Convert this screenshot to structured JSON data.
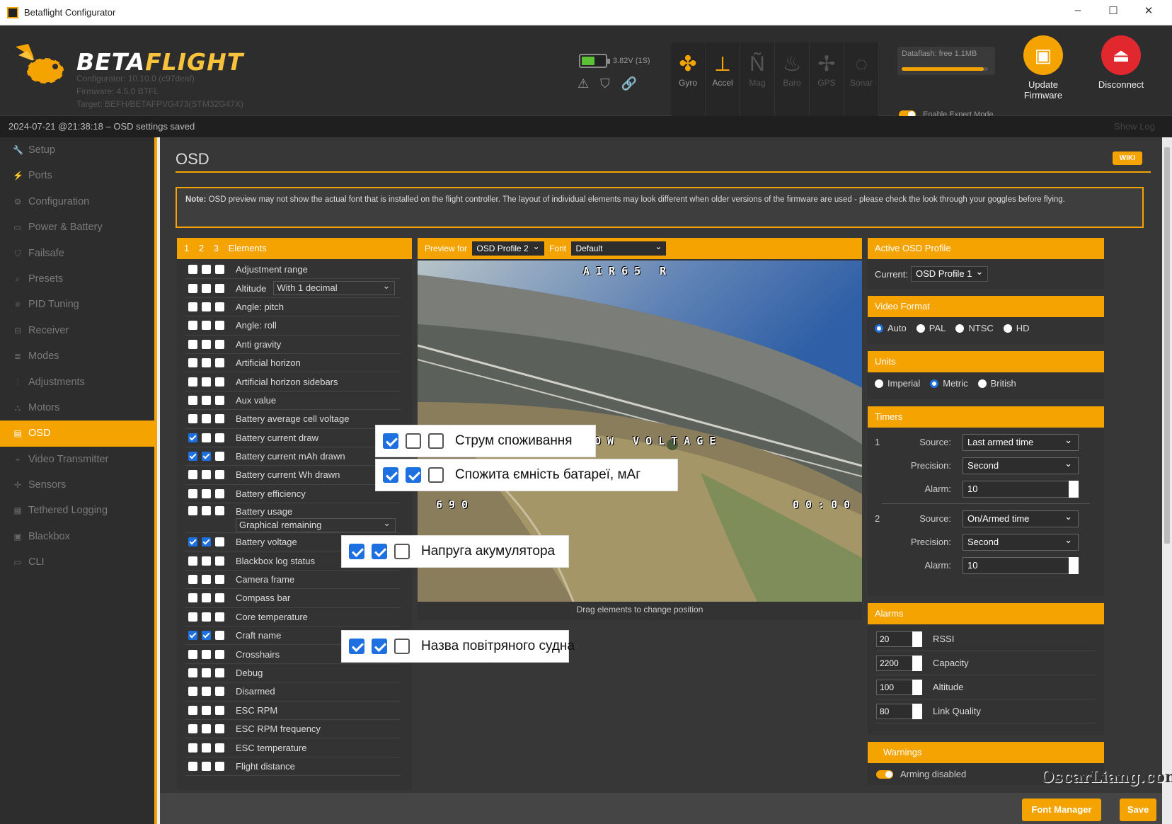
{
  "window": {
    "title": "Betaflight Configurator",
    "buttons": [
      "–",
      "☐",
      "✕"
    ]
  },
  "header": {
    "logo": {
      "betaflight_left": "BETA",
      "betaflight_right": "FLIGHT"
    },
    "fw_lines": [
      "Configurator: 10.10.0 (c97deaf)",
      "Firmware: 4.5.0 BTFL",
      "Target: BEFH/BETAFPVG473(STM32G47X)"
    ],
    "battery": {
      "voltage": "3.82V (1S)",
      "level": 0.55,
      "color": "#5bc236"
    },
    "status_icons": [
      "warning-icon",
      "shield-icon",
      "link-icon"
    ],
    "sensors": [
      {
        "label": "Gyro",
        "icon": "gyro-icon",
        "active": true
      },
      {
        "label": "Accel",
        "icon": "accel-icon",
        "active": true
      },
      {
        "label": "Mag",
        "icon": "mag-icon",
        "active": false
      },
      {
        "label": "Baro",
        "icon": "baro-icon",
        "active": false
      },
      {
        "label": "GPS",
        "icon": "gps-icon",
        "active": false
      },
      {
        "label": "Sonar",
        "icon": "sonar-icon",
        "active": false
      }
    ],
    "dataflash": {
      "label": "Dataflash: free 1.1MB",
      "used": 0.95
    },
    "expert_mode": "Enable Expert Mode",
    "update_firmware": {
      "line1": "Update",
      "line2": "Firmware",
      "color": "#f5a300"
    },
    "disconnect": {
      "label": "Disconnect",
      "color": "#e0282e"
    }
  },
  "statusbar": {
    "message": "2024-07-21 @21:38:18 – OSD settings saved",
    "show_log": "Show Log"
  },
  "sidebar": {
    "items": [
      {
        "label": "Setup",
        "icon": "wrench-icon"
      },
      {
        "label": "Ports",
        "icon": "plug-icon"
      },
      {
        "label": "Configuration",
        "icon": "gear-icon"
      },
      {
        "label": "Power & Battery",
        "icon": "battery-icon"
      },
      {
        "label": "Failsafe",
        "icon": "shield-icon"
      },
      {
        "label": "Presets",
        "icon": "search-icon"
      },
      {
        "label": "PID Tuning",
        "icon": "pid-icon"
      },
      {
        "label": "Receiver",
        "icon": "receiver-icon"
      },
      {
        "label": "Modes",
        "icon": "modes-icon"
      },
      {
        "label": "Adjustments",
        "icon": "sliders-icon"
      },
      {
        "label": "Motors",
        "icon": "motor-icon"
      },
      {
        "label": "OSD",
        "icon": "osd-icon",
        "active": true
      },
      {
        "label": "Video Transmitter",
        "icon": "antenna-icon"
      },
      {
        "label": "Sensors",
        "icon": "sensors-icon"
      },
      {
        "label": "Tethered Logging",
        "icon": "log-icon"
      },
      {
        "label": "Blackbox",
        "icon": "blackbox-icon"
      },
      {
        "label": "CLI",
        "icon": "terminal-icon"
      }
    ]
  },
  "page": {
    "title": "OSD",
    "wiki": "WIKI",
    "note_label": "Note:",
    "note_text": " OSD preview may not show the actual font that is installed on the flight controller. The layout of individual elements may look different when older versions of the firmware are used - please check the look through your goggles before flying."
  },
  "elements": {
    "profiles": [
      "1",
      "2",
      "3"
    ],
    "header": "Elements",
    "rows": [
      {
        "label": "Adjustment range",
        "checks": [
          false,
          false,
          false
        ]
      },
      {
        "label": "Altitude",
        "checks": [
          false,
          false,
          false
        ],
        "select": "With 1 decimal"
      },
      {
        "label": "Angle: pitch",
        "checks": [
          false,
          false,
          false
        ]
      },
      {
        "label": "Angle: roll",
        "checks": [
          false,
          false,
          false
        ]
      },
      {
        "label": "Anti gravity",
        "checks": [
          false,
          false,
          false
        ]
      },
      {
        "label": "Artificial horizon",
        "checks": [
          false,
          false,
          false
        ]
      },
      {
        "label": "Artificial horizon sidebars",
        "checks": [
          false,
          false,
          false
        ]
      },
      {
        "label": "Aux value",
        "checks": [
          false,
          false,
          false
        ]
      },
      {
        "label": "Battery average cell voltage",
        "checks": [
          false,
          false,
          false
        ]
      },
      {
        "label": "Battery current draw",
        "checks": [
          true,
          false,
          false
        ]
      },
      {
        "label": "Battery current mAh drawn",
        "checks": [
          true,
          true,
          false
        ]
      },
      {
        "label": "Battery current Wh drawn",
        "checks": [
          false,
          false,
          false
        ]
      },
      {
        "label": "Battery efficiency",
        "checks": [
          false,
          false,
          false
        ]
      },
      {
        "label": "Battery usage",
        "checks": [
          false,
          false,
          false
        ],
        "select": "Graphical remaining",
        "tall": true
      },
      {
        "label": "Battery voltage",
        "checks": [
          true,
          true,
          false
        ]
      },
      {
        "label": "Blackbox log status",
        "checks": [
          false,
          false,
          false
        ]
      },
      {
        "label": "Camera frame",
        "checks": [
          false,
          false,
          false
        ]
      },
      {
        "label": "Compass bar",
        "checks": [
          false,
          false,
          false
        ]
      },
      {
        "label": "Core temperature",
        "checks": [
          false,
          false,
          false
        ]
      },
      {
        "label": "Craft name",
        "checks": [
          true,
          true,
          false
        ]
      },
      {
        "label": "Crosshairs",
        "checks": [
          false,
          false,
          false
        ]
      },
      {
        "label": "Debug",
        "checks": [
          false,
          false,
          false
        ]
      },
      {
        "label": "Disarmed",
        "checks": [
          false,
          false,
          false
        ]
      },
      {
        "label": "ESC RPM",
        "checks": [
          false,
          false,
          false
        ]
      },
      {
        "label": "ESC RPM frequency",
        "checks": [
          false,
          false,
          false
        ]
      },
      {
        "label": "ESC temperature",
        "checks": [
          false,
          false,
          false
        ]
      },
      {
        "label": "Flight distance",
        "checks": [
          false,
          false,
          false
        ]
      }
    ]
  },
  "preview": {
    "preview_for": "Preview for",
    "profile": "OSD Profile 2",
    "font_label": "Font",
    "font": "Default",
    "osd_craft": "AIR65 R",
    "osd_warning": "LOW VOLTAGE",
    "osd_mah": "690",
    "osd_timer": "00:00",
    "drag_hint": "Drag elements to change position"
  },
  "right": {
    "active_profile": {
      "title": "Active OSD Profile",
      "label": "Current:",
      "value": "OSD Profile 1"
    },
    "video_format": {
      "title": "Video Format",
      "options": [
        "Auto",
        "PAL",
        "NTSC",
        "HD"
      ],
      "selected": "Auto"
    },
    "units": {
      "title": "Units",
      "options": [
        "Imperial",
        "Metric",
        "British"
      ],
      "selected": "Metric"
    },
    "timers": {
      "title": "Timers",
      "items": [
        {
          "num": "1",
          "source_label": "Source:",
          "source": "Last armed time",
          "precision_label": "Precision:",
          "precision": "Second",
          "alarm_label": "Alarm:",
          "alarm": "10"
        },
        {
          "num": "2",
          "source_label": "Source:",
          "source": "On/Armed time",
          "precision_label": "Precision:",
          "precision": "Second",
          "alarm_label": "Alarm:",
          "alarm": "10"
        }
      ]
    },
    "alarms": {
      "title": "Alarms",
      "items": [
        {
          "value": "20",
          "label": "RSSI"
        },
        {
          "value": "2200",
          "label": "Capacity"
        },
        {
          "value": "100",
          "label": "Altitude"
        },
        {
          "value": "80",
          "label": "Link Quality"
        }
      ]
    },
    "warnings": {
      "title": "Warnings",
      "first": "Arming disabled"
    }
  },
  "footer": {
    "font_manager": "Font Manager",
    "save": "Save"
  },
  "watermark": "OscarLiang.com",
  "overlays": [
    {
      "text": "Струм споживання",
      "checks": [
        true,
        false,
        false
      ]
    },
    {
      "text": "Спожита ємність батареї, мАг",
      "checks": [
        true,
        true,
        false
      ]
    },
    {
      "text": "Напруга акумулятора",
      "checks": [
        true,
        true,
        false
      ]
    },
    {
      "text": "Назва повітряного судна",
      "checks": [
        true,
        true,
        false
      ]
    }
  ],
  "colors": {
    "accent": "#f5a300",
    "checkbox_blue": "#1e6fe0"
  }
}
